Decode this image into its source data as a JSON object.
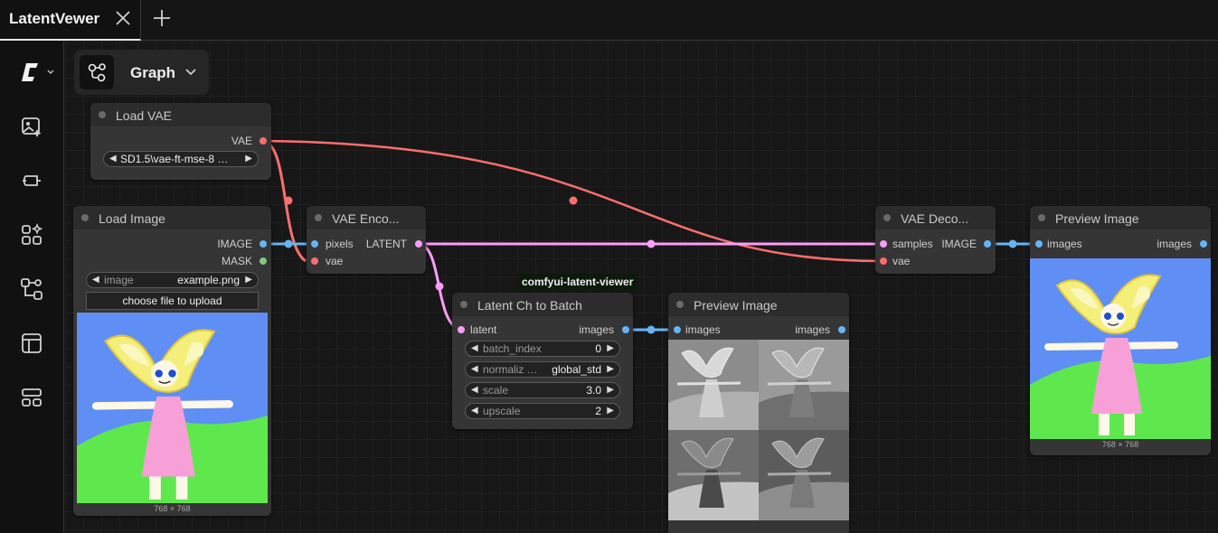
{
  "tab": {
    "title": "LatentVewer"
  },
  "graph_menu": {
    "label": "Graph"
  },
  "group": {
    "label": "comfyui-latent-viewer"
  },
  "nodes": {
    "load_vae": {
      "title": "Load VAE",
      "output": "VAE",
      "widget_value": "SD1.5\\vae-ft-mse-8 …"
    },
    "load_image": {
      "title": "Load Image",
      "outputs": [
        "IMAGE",
        "MASK"
      ],
      "image_widget_name": "image",
      "image_widget_value": "example.png",
      "upload_button": "choose file to upload",
      "dims": "768 × 768"
    },
    "vae_encode": {
      "title": "VAE Enco...",
      "inputs": [
        "pixels",
        "vae"
      ],
      "output": "LATENT"
    },
    "latent_batch": {
      "title": "Latent Ch to Batch",
      "input": "latent",
      "output": "images",
      "widgets": [
        {
          "name": "batch_index",
          "value": "0"
        },
        {
          "name": "normaliz …",
          "value": "global_std"
        },
        {
          "name": "scale",
          "value": "3.0"
        },
        {
          "name": "upscale",
          "value": "2"
        }
      ]
    },
    "preview_mid": {
      "title": "Preview Image",
      "input": "images",
      "output": "images"
    },
    "vae_decode": {
      "title": "VAE Deco...",
      "inputs": [
        "samples",
        "vae"
      ],
      "output": "IMAGE"
    },
    "preview_right": {
      "title": "Preview Image",
      "input": "images",
      "output": "images",
      "dims": "768 × 768"
    }
  },
  "colors": {
    "image": "#64b5f6",
    "latent": "#ff9cf9",
    "vae": "#ff6e6e",
    "mask": "#81c784"
  },
  "sidebar_icons": [
    "comfy-logo-icon",
    "image-sparkle-icon",
    "model-icon",
    "nodes-library-icon",
    "workflow-icon",
    "template-icon",
    "queue-icon"
  ]
}
